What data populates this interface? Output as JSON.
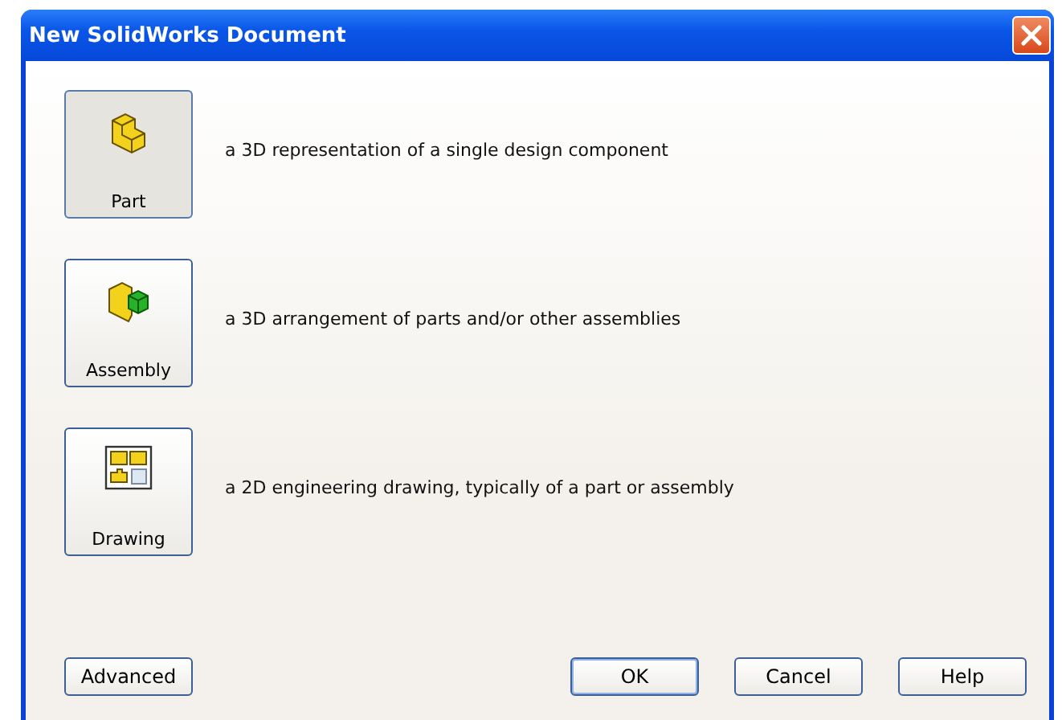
{
  "window": {
    "title": "New SolidWorks Document"
  },
  "templates": [
    {
      "kind": "part",
      "label": "Part",
      "description": "a 3D representation of a single design component",
      "selected": true
    },
    {
      "kind": "assembly",
      "label": "Assembly",
      "description": "a 3D arrangement of parts and/or other assemblies",
      "selected": false
    },
    {
      "kind": "drawing",
      "label": "Drawing",
      "description": "a 2D engineering drawing, typically of a part or assembly",
      "selected": false
    }
  ],
  "buttons": [
    {
      "label": "Advanced",
      "default": false
    },
    {
      "label": "OK",
      "default": true
    },
    {
      "label": "Cancel",
      "default": false
    },
    {
      "label": "Help",
      "default": false
    }
  ]
}
